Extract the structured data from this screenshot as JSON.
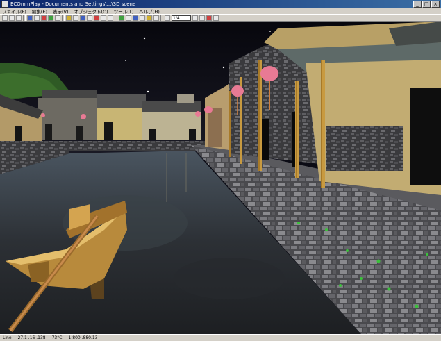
{
  "window": {
    "title": "ECOmmPlay - Documents and Settings\\...\\3D scene",
    "buttons": [
      "_",
      "□",
      "×"
    ]
  },
  "menubar": {
    "items": [
      "ファイル(F)",
      "編集(E)",
      "表示(V)",
      "オブジェクト(O)",
      "ツール(T)",
      "ヘルプ(H)"
    ]
  },
  "toolbar": {
    "select_value": "1/4"
  },
  "status": {
    "items": [
      "Line",
      "27.1 .16 .138",
      "73°C",
      "1:800 .880.13"
    ]
  },
  "scene": {
    "description_icon": "3d-viewport"
  }
}
